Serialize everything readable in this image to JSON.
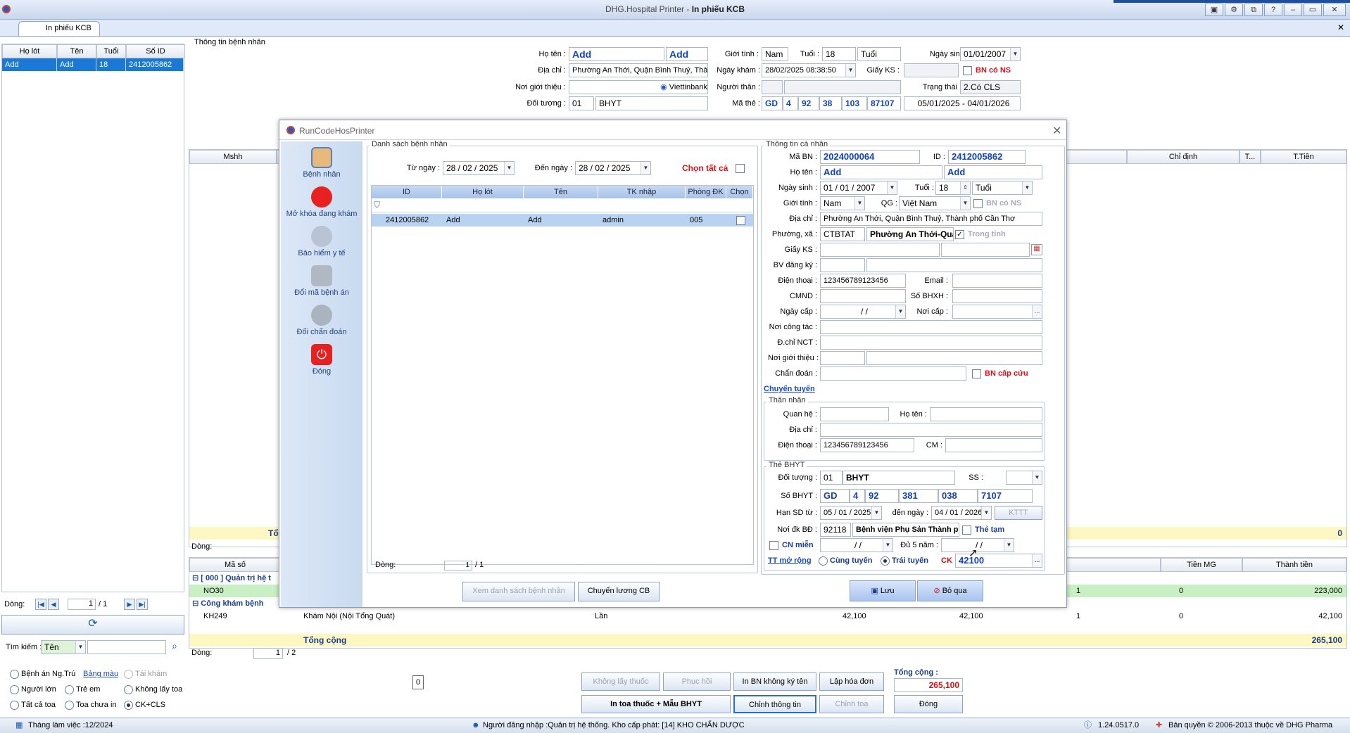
{
  "window": {
    "app_name": "DHG.Hospital Printer",
    "title_sep": " - ",
    "title": "In phiếu KCB",
    "close_tab": "✕"
  },
  "tab": {
    "label": "In phiếu KCB"
  },
  "left_list": {
    "headers": [
      "Họ lót",
      "Tên",
      "Tuổi",
      "Số ID"
    ],
    "rows": [
      {
        "ho_lot": "Add",
        "ten": "Add",
        "tuoi": "18",
        "so_id": "2412005862"
      }
    ],
    "pager": {
      "label": "Dòng:",
      "page": "1",
      "total": "/ 1"
    }
  },
  "search": {
    "label": "Tìm kiếm :",
    "field": "Tên"
  },
  "filters": {
    "benh_an_ngtru": "Bệnh án Ng.Trú",
    "bang_mau": "Bảng màu",
    "tai_kham": "Tái khám",
    "nguoi_lon": "Người lớn",
    "tre_em": "Trẻ em",
    "khong_lay_toa": "Không lấy toa",
    "tat_ca_toa": "Tất cả toa",
    "toa_chua_in": "Toa chưa in",
    "ck_cls": "CK+CLS"
  },
  "patient_info": {
    "section": "Thông tin bệnh nhân",
    "ho_ten_label": "Họ tên :",
    "ho": "Add",
    "ten": "Add",
    "gioi_tinh_label": "Giới tính :",
    "gioi_tinh": "Nam",
    "tuoi_label": "Tuổi :",
    "tuoi": "18",
    "tuoi_unit": "Tuổi",
    "ngay_sinh_label": "Ngày sinh :",
    "ngay_sinh": "01/01/2007",
    "dia_chi_label": "Địa chỉ :",
    "dia_chi": "Phường An Thới, Quận Bình Thuỷ, Thành",
    "ngay_kham_label": "Ngày khám :",
    "ngay_kham": "28/02/2025 08:38:50",
    "giay_ks_label": "Giấy KS :",
    "bn_co_ns": "BN có NS",
    "noi_gioi_thieu_label": "Nơi giới thiệu :",
    "bank": "Viettinbank",
    "nguoi_than_label": "Người thân :",
    "trang_thai_label": "Trạng thái :",
    "trang_thai": "2.Có CLS",
    "doi_tuong_label": "Đối tượng :",
    "doi_tuong_code": "01",
    "doi_tuong": "BHYT",
    "ma_the_label": "Mã thẻ :",
    "ma_the": [
      "GD",
      "4",
      "92",
      "38",
      "103",
      "87107"
    ],
    "hieu_luc": "05/01/2025 - 04/01/2026"
  },
  "main_table": {
    "headers": [
      "Mshh",
      "Chỉ định",
      "T...",
      "T.Tiền"
    ],
    "summary_prefix": "Tổ",
    "summary_right": "0",
    "pager_label": "Dòng:"
  },
  "bottom_table": {
    "headers": [
      "Mã số",
      "Tiền MG",
      "Thành tiền"
    ],
    "group1": "[ 000 ] Quản trị hệ t",
    "row1": {
      "code": "NO30",
      "qty": "1",
      "mg": "0",
      "total": "223,000"
    },
    "group2": "Công khám bệnh",
    "row2": {
      "code": "KH249",
      "name": "Khám Nội (Nội Tổng Quát)",
      "unit": "Lần",
      "price": "42,100",
      "price2": "42,100",
      "qty": "1",
      "mg": "0",
      "total": "42,100"
    },
    "tong_cong": "Tổng cộng",
    "tong_cong_value": "265,100",
    "pager": {
      "label": "Dòng:",
      "page": "1",
      "total": "/ 2"
    }
  },
  "toolbar": {
    "counter": "0",
    "khong_lay_thuoc": "Không lấy thuốc",
    "phuc_hoi": "Phục hồi",
    "in_bn_khong_ky_ten": "In BN không ký tên",
    "lap_hoa_don": "Lập hóa đơn",
    "in_toa": "In toa thuốc + Mẫu BHYT",
    "chinh_thong_tin": "Chỉnh thông tin",
    "chinh_toa": "Chỉnh toa",
    "dong": "Đóng",
    "tong_cong_label": "Tổng cộng :",
    "tong_cong": "265,100"
  },
  "statusbar": {
    "thang": "Tháng làm việc :12/2024",
    "nguoi_dang_nhap": "Người đăng nhập :Quản trị hệ thống. Kho cấp phát: [14] KHO CHẨN DƯỢC",
    "version": "1.24.0517.0",
    "ban_quyen": "Bản quyền © 2006-2013 thuộc về DHG Pharma"
  },
  "modal": {
    "title": "RunCodeHosPrinter",
    "nav": [
      "Bệnh nhân",
      "Mở khóa đang khám",
      "Bảo hiểm y tế",
      "Đổi mã bệnh án",
      "Đổi chẩn đoán",
      "Đóng"
    ],
    "danh_sach": {
      "section": "Danh sách bệnh nhân",
      "tu_ngay_label": "Từ ngày :",
      "tu_ngay": "28 / 02 / 2025",
      "den_ngay_label": "Đến ngày :",
      "den_ngay": "28 / 02 / 2025",
      "chon_tat_ca": "Chọn tất cả",
      "headers": [
        "ID",
        "Họ lót",
        "Tên",
        "TK nhập",
        "Phòng ĐK",
        "Chọn"
      ],
      "rows": [
        {
          "id": "2412005862",
          "ho_lot": "Add",
          "ten": "Add",
          "tk": "admin",
          "phong": "005"
        }
      ],
      "pager": {
        "label": "Dòng:",
        "page": "1",
        "total": "/ 1"
      }
    },
    "xem_ds": "Xem danh sách bệnh nhân",
    "chuyen_luong": "Chuyển lương CB",
    "tt": {
      "section": "Thông tin cá nhân",
      "ma_bn_label": "Mã BN :",
      "ma_bn": "2024000064",
      "id_label": "ID :",
      "id": "2412005862",
      "ho_ten_label": "Họ tên :",
      "ho": "Add",
      "ten": "Add",
      "ngay_sinh_label": "Ngày sinh :",
      "ngay_sinh": "01 / 01 / 2007",
      "tuoi_label": "Tuổi :",
      "tuoi": "18",
      "tuoi_unit": "Tuổi",
      "gioi_tinh_label": "Giới tính :",
      "gioi_tinh": "Nam",
      "qg_label": "QG :",
      "qg": "Việt Nam",
      "bn_co_ns": "BN có NS",
      "dia_chi_label": "Địa chỉ :",
      "dia_chi": "Phường An Thới, Quận Bình Thuỷ, Thành phố Cần Thơ",
      "phuong_label": "Phường, xã :",
      "phuong_code": "CTBTAT",
      "phuong": "Phường An Thới-Quận Bình",
      "trong_tinh": "Trong tỉnh",
      "giay_ks_label": "Giấy KS :",
      "bv_dang_ky_label": "BV đăng ký :",
      "dien_thoai_label": "Điện thoại :",
      "dien_thoai": "123456789123456",
      "email_label": "Email :",
      "cmnd_label": "CMND :",
      "so_bhxh_label": "Số BHXH :",
      "ngay_cap_label": "Ngày cấp :",
      "ngay_cap": "/ /",
      "noi_cap_label": "Nơi cấp :",
      "noi_cong_tac_label": "Nơi công tác :",
      "dchi_nct_label": "Đ.chỉ NCT :",
      "noi_gioi_thieu_label": "Nơi giới thiệu :",
      "chan_doan_label": "Chẩn đoán :",
      "bn_cap_cuu": "BN cấp cứu",
      "chuyen_tuyen": "Chuyển tuyến"
    },
    "than_nhan": {
      "section": "Thân nhân",
      "quan_he_label": "Quan hệ :",
      "ho_ten_label": "Họ tên :",
      "dia_chi_label": "Địa chỉ :",
      "dien_thoai_label": "Điện thoại :",
      "dien_thoai": "123456789123456",
      "cm_label": "CM :"
    },
    "bhyt": {
      "section": "Thẻ BHYT",
      "doi_tuong_label": "Đối tượng :",
      "doi_tuong_code": "01",
      "doi_tuong": "BHYT",
      "ss_label": "SS :",
      "so_bhyt_label": "Số BHYT :",
      "so_bhyt": [
        "GD",
        "4",
        "92",
        "381",
        "038",
        "7107"
      ],
      "han_sd_label": "Hạn SD từ :",
      "han_tu": "05 / 01 / 2025",
      "den_ngay_label": "đến ngày :",
      "han_den": "04 / 01 / 2026",
      "kttt": "KTTT",
      "noi_dk_label": "Nơi đk BĐ :",
      "noi_dk_code": "92118",
      "noi_dk": "Bệnh viện Phụ Sản Thành phố C",
      "the_tam": "Thẻ tạm",
      "cn_mien": "CN miễn",
      "cn_mien_value": "/ /",
      "du5nam_label": "Đủ 5 năm :",
      "du5nam": "/ /",
      "tt_mo_rong": "TT mở rộng",
      "cung_tuyen": "Cùng tuyến",
      "trai_tuyen": "Trái tuyến",
      "ck_label": "CK",
      "ck": "42100"
    },
    "luu": "Lưu",
    "bo_qua": "Bỏ qua"
  }
}
